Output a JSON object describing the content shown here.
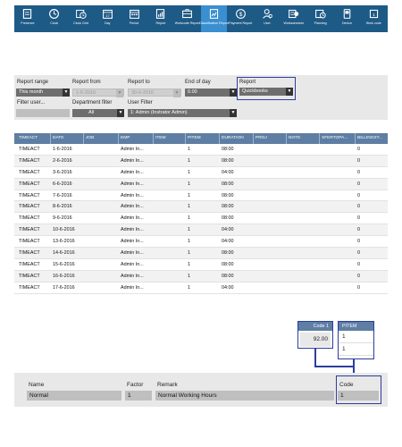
{
  "toolbar": {
    "items": [
      {
        "label": "Presence",
        "icon": "id-card-icon"
      },
      {
        "label": "Clock",
        "icon": "clock-icon"
      },
      {
        "label": "Clock Grid",
        "icon": "clock-grid-icon"
      },
      {
        "label": "Day",
        "icon": "calendar-day-icon"
      },
      {
        "label": "Period",
        "icon": "calendar-period-icon"
      },
      {
        "label": "Report",
        "icon": "report-icon"
      },
      {
        "label": "Workcode Report",
        "icon": "workcode-report-icon"
      },
      {
        "label": "Classification Report",
        "icon": "classification-report-icon",
        "active": true
      },
      {
        "label": "Payment Report",
        "icon": "dollar-icon"
      },
      {
        "label": "User",
        "icon": "user-icon"
      },
      {
        "label": "Workschedule",
        "icon": "workschedule-icon"
      },
      {
        "label": "Planning",
        "icon": "planning-icon"
      },
      {
        "label": "Device",
        "icon": "device-icon"
      },
      {
        "label": "Work code",
        "icon": "work-code-icon"
      }
    ],
    "accent": "#1e5a86",
    "active_color": "#3a8fd0"
  },
  "filters": {
    "report_range": {
      "label": "Report range",
      "value": "This month"
    },
    "report_from": {
      "label": "Report from",
      "value": "1-6-2016"
    },
    "report_to": {
      "label": "Report to",
      "value": "30-6-2016"
    },
    "end_of_day": {
      "label": "End of day",
      "value": "0.00"
    },
    "report": {
      "label": "Report",
      "value": "Quickbooks"
    },
    "filter_user": {
      "label": "Filter user...",
      "value": ""
    },
    "department_filter": {
      "label": "Department filter",
      "value": "All"
    },
    "user_filter": {
      "label": "User Filter",
      "value": "1: Admin (Instrator Admin)"
    }
  },
  "table": {
    "columns": [
      "TIMEACT",
      "DATE",
      "JOB",
      "EMP",
      "ITEM",
      "PITEM",
      "DURATION",
      "PROJ",
      "NOTE",
      "XFERTOPA...",
      "BILLINGST..."
    ],
    "rows": [
      [
        "TIMEACT",
        "1-6-2016",
        "",
        "Admin In...",
        "",
        "1",
        "08:00",
        "",
        "",
        "",
        "0"
      ],
      [
        "TIMEACT",
        "2-6-2016",
        "",
        "Admin In...",
        "",
        "1",
        "08:00",
        "",
        "",
        "",
        "0"
      ],
      [
        "TIMEACT",
        "3-6-2016",
        "",
        "Admin In...",
        "",
        "1",
        "04:00",
        "",
        "",
        "",
        "0"
      ],
      [
        "TIMEACT",
        "6-6-2016",
        "",
        "Admin In...",
        "",
        "1",
        "08:00",
        "",
        "",
        "",
        "0"
      ],
      [
        "TIMEACT",
        "7-6-2016",
        "",
        "Admin In...",
        "",
        "1",
        "08:00",
        "",
        "",
        "",
        "0"
      ],
      [
        "TIMEACT",
        "8-6-2016",
        "",
        "Admin In...",
        "",
        "1",
        "08:00",
        "",
        "",
        "",
        "0"
      ],
      [
        "TIMEACT",
        "9-6-2016",
        "",
        "Admin In...",
        "",
        "1",
        "08:00",
        "",
        "",
        "",
        "0"
      ],
      [
        "TIMEACT",
        "10-6-2016",
        "",
        "Admin In...",
        "",
        "1",
        "04:00",
        "",
        "",
        "",
        "0"
      ],
      [
        "TIMEACT",
        "13-6-2016",
        "",
        "Admin In...",
        "",
        "1",
        "04:00",
        "",
        "",
        "",
        "0"
      ],
      [
        "TIMEACT",
        "14-6-2016",
        "",
        "Admin In...",
        "",
        "1",
        "08:00",
        "",
        "",
        "",
        "0"
      ],
      [
        "TIMEACT",
        "15-6-2016",
        "",
        "Admin In...",
        "",
        "1",
        "08:00",
        "",
        "",
        "",
        "0"
      ],
      [
        "TIMEACT",
        "16-6-2016",
        "",
        "Admin In...",
        "",
        "1",
        "08:00",
        "",
        "",
        "",
        "0"
      ],
      [
        "TIMEACT",
        "17-6-2016",
        "",
        "Admin In...",
        "",
        "1",
        "04:00",
        "",
        "",
        "",
        "0"
      ]
    ]
  },
  "code_box": {
    "header": "Code 1",
    "value": "92.00"
  },
  "pitem_box": {
    "header": "PITEM",
    "values": [
      "1",
      "1"
    ]
  },
  "bottom": {
    "name_label": "Name",
    "name_value": "Normal",
    "factor_label": "Factor",
    "factor_value": "1",
    "remark_label": "Remark",
    "remark_value": "Normal Working Hours",
    "code_label": "Code",
    "code_value": "1"
  },
  "colors": {
    "header": "#5e7ea3",
    "highlight": "#2c3e9e",
    "panel": "#e8e8e8"
  }
}
